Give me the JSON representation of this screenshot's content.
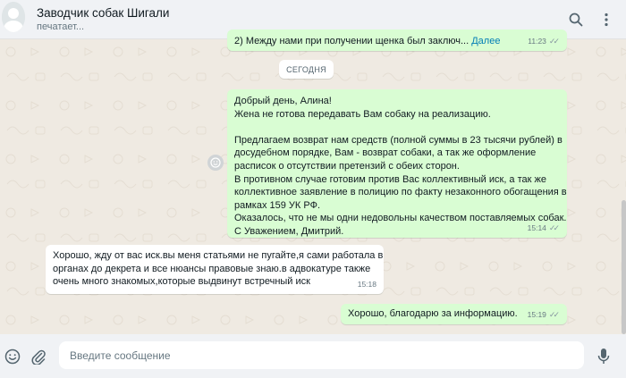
{
  "header": {
    "title": "Заводчик собак Шигали",
    "status": "печатает..."
  },
  "messages": [
    {
      "direction": "out",
      "lines": [
        "2) Между нами при получении щенка был заключ..."
      ],
      "more_label": "Далее",
      "time": "11:23",
      "ticks": "✓✓"
    },
    {
      "direction": "out",
      "lines": [
        "Добрый день, Алина!",
        "Жена не готова передавать Вам собаку на реализацию.",
        "",
        "Предлагаем возврат нам средств (полной суммы в 23 тысячи рублей) в",
        "досудебном порядке, Вам - возврат собаки, а так же оформление",
        "расписок о отсутствии претензий с обеих сторон.",
        "В противном случае готовим против Вас коллективный иск, а так же",
        "коллективное заявление в полицию по факту незаконного обогащения в",
        "рамках 159 УК РФ.",
        "Оказалось, что не мы одни недовольны качеством поставляемых собак.",
        "С Уважением, Дмитрий."
      ],
      "time": "15:14",
      "ticks": "✓✓"
    },
    {
      "direction": "in",
      "lines": [
        "Хорошо, жду от вас иск.вы меня статьями не пугайте,я сами работала в",
        "органах до декрета и все нюансы правовые знаю.в адвокатуре также",
        "очень много знакомых,которые выдвинут встречный иск"
      ],
      "time": "15:18"
    },
    {
      "direction": "out",
      "lines": [
        "Хорошо, благодарю за информацию."
      ],
      "time": "15:19",
      "ticks": "✓✓"
    }
  ],
  "date_divider": "СЕГОДНЯ",
  "composer": {
    "placeholder": "Введите сообщение"
  },
  "colors": {
    "outgoing_bubble": "#d9fdd3",
    "incoming_bubble": "#ffffff",
    "chat_background": "#efeae2",
    "link": "#027eb5"
  },
  "icons": {
    "search": "search-icon",
    "menu": "kebab-menu-icon",
    "emoji": "emoji-icon",
    "attach": "paperclip-icon",
    "mic": "microphone-icon",
    "react": "emoji-reaction-icon"
  }
}
